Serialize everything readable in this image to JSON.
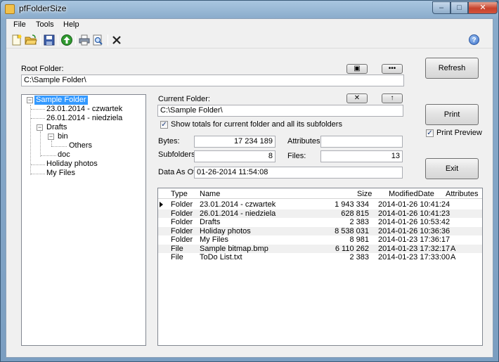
{
  "window": {
    "title": "pfFolderSize",
    "minimize": "–",
    "maximize": "□",
    "close": "✕"
  },
  "menu": {
    "file": "File",
    "tools": "Tools",
    "help": "Help"
  },
  "toolbar": {
    "icons": [
      "new-icon",
      "open-folder-icon",
      "save-icon",
      "up-arrow-icon",
      "print-icon",
      "print-preview-icon",
      "delete-icon",
      "help-icon"
    ],
    "help_glyph": "?"
  },
  "root": {
    "label": "Root Folder:",
    "value": "C:\\Sample Folder\\",
    "pick_glyph": "▣",
    "browse_label": "•••"
  },
  "tree": {
    "nodes": [
      {
        "text": "Sample Folder",
        "selected": true
      },
      {
        "text": "23.01.2014 - czwartek"
      },
      {
        "text": "26.01.2014 - niedziela"
      },
      {
        "text": "Drafts"
      },
      {
        "text": "bin"
      },
      {
        "text": "Others"
      },
      {
        "text": "doc"
      },
      {
        "text": "Holiday photos"
      },
      {
        "text": "My Files"
      }
    ],
    "minus": "−"
  },
  "current": {
    "label": "Current Folder:",
    "value": "C:\\Sample Folder\\",
    "clear_glyph": "✕",
    "up_glyph": "↑"
  },
  "totals": {
    "label": "Show totals for current folder and all its subfolders",
    "checked": "✓"
  },
  "stats": {
    "bytes_label": "Bytes:",
    "bytes": "17 234 189",
    "attributes_label": "Attributes:",
    "attributes": "",
    "subfolders_label": "Subfolders:",
    "subfolders": "8",
    "files_label": "Files:",
    "files": "13",
    "asof_label": "Data As Of:",
    "asof": "01-26-2014 11:54:08"
  },
  "buttons": {
    "refresh": "Refresh",
    "print": "Print",
    "exit": "Exit"
  },
  "print_preview": {
    "label": "Print Preview",
    "checked": "✓"
  },
  "grid": {
    "headers": {
      "type": "Type",
      "name": "Name",
      "size": "Size",
      "modified": "ModifiedDate",
      "attributes": "Attributes"
    },
    "rows": [
      {
        "type": "Folder",
        "name": "23.01.2014 - czwartek",
        "size": "1 943 334",
        "modified": "2014-01-26 10:41:24",
        "attributes": ""
      },
      {
        "type": "Folder",
        "name": "26.01.2014 - niedziela",
        "size": "628 815",
        "modified": "2014-01-26 10:41:23",
        "attributes": ""
      },
      {
        "type": "Folder",
        "name": "Drafts",
        "size": "2 383",
        "modified": "2014-01-26 10:53:42",
        "attributes": ""
      },
      {
        "type": "Folder",
        "name": "Holiday photos",
        "size": "8 538 031",
        "modified": "2014-01-26 10:36:36",
        "attributes": ""
      },
      {
        "type": "Folder",
        "name": "My Files",
        "size": "8 981",
        "modified": "2014-01-23 17:36:17",
        "attributes": ""
      },
      {
        "type": "File",
        "name": "Sample bitmap.bmp",
        "size": "6 110 262",
        "modified": "2014-01-23 17:32:17",
        "attributes": "A"
      },
      {
        "type": "File",
        "name": "ToDo List.txt",
        "size": "2 383",
        "modified": "2014-01-23 17:33:00",
        "attributes": "A"
      }
    ]
  }
}
